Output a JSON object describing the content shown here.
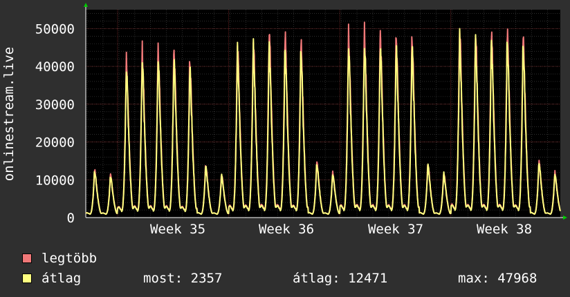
{
  "chart_data": {
    "type": "line",
    "title": "",
    "ylabel": "onlinestream.live",
    "ylim": [
      0,
      55000
    ],
    "yticks": [
      0,
      10000,
      20000,
      30000,
      40000,
      50000
    ],
    "ytick_labels": [
      "0",
      "10000",
      "20000",
      "30000",
      "40000",
      "50000"
    ],
    "xlabels": [
      "Week 35",
      "Week 36",
      "Week 37",
      "Week 38"
    ],
    "grid": true,
    "legend_placement": "bottom-left",
    "colors": {
      "background": "#2f2f2f",
      "plot_bg": "#000000",
      "grid": "#4a4a4a",
      "grid_major": "#7a2a2a",
      "max": "#f07878",
      "avg": "#ffff80",
      "axis_arrow": "#00cc00"
    },
    "series": [
      {
        "name": "legtöbb",
        "color": "#f07878",
        "daily_peaks": [
          12800,
          11500,
          42200,
          44800,
          45300,
          45200,
          42500,
          14200,
          11700,
          47000,
          48000,
          50500,
          49700,
          47500,
          14900,
          12000,
          49000,
          50000,
          49500,
          49000,
          49000,
          14500,
          12000,
          51300,
          50100,
          50400,
          50500,
          49000,
          15000,
          12000
        ]
      },
      {
        "name": "átlag",
        "color": "#ffff80",
        "daily_peaks": [
          12500,
          11200,
          40000,
          42200,
          42800,
          42500,
          40000,
          13800,
          11300,
          44500,
          45500,
          46000,
          45500,
          45000,
          14500,
          11700,
          46000,
          46500,
          46200,
          46000,
          46000,
          14200,
          11700,
          47900,
          47200,
          47300,
          47500,
          46500,
          14700,
          11700
        ]
      }
    ],
    "legend": {
      "max_label": "legtöbb",
      "avg_label": "átlag",
      "stats": {
        "most": "most: 2357",
        "atlag": "átlag: 12471",
        "max": "max: 47968"
      }
    }
  }
}
